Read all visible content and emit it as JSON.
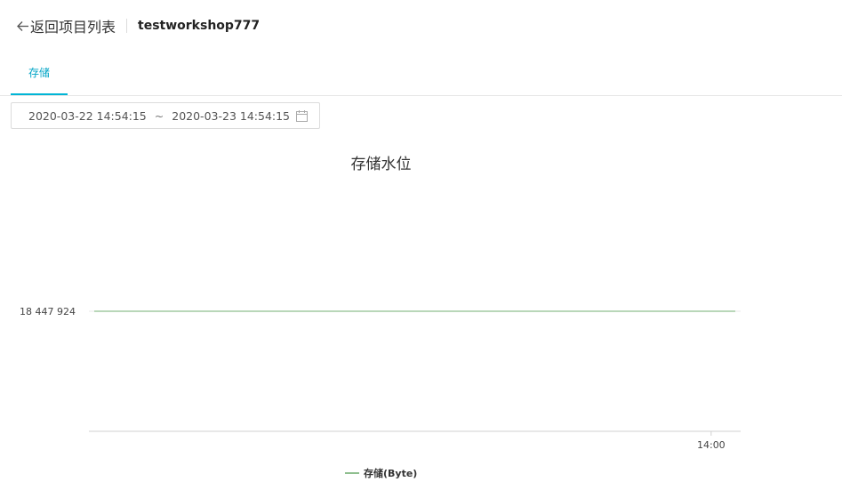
{
  "header": {
    "back_label": "返回项目列表",
    "project_name": "testworkshop777"
  },
  "tabs": [
    {
      "label": "存储",
      "active": true
    }
  ],
  "date_range": {
    "start": "2020-03-22 14:54:15",
    "separator": "~",
    "end": "2020-03-23 14:54:15"
  },
  "colors": {
    "accent": "#00b5d6",
    "series": "#8fbf8f"
  },
  "chart_data": {
    "type": "line",
    "title": "存储水位",
    "x_ticks": [
      "14:00"
    ],
    "y_ticks": [
      "18 447 924"
    ],
    "series": [
      {
        "name": "存储(Byte)",
        "x": [
          "2020-03-22 14:54:15",
          "2020-03-23 14:54:15"
        ],
        "values": [
          18447924,
          18447924
        ]
      }
    ],
    "legend": "bottom-center",
    "grid": true
  }
}
